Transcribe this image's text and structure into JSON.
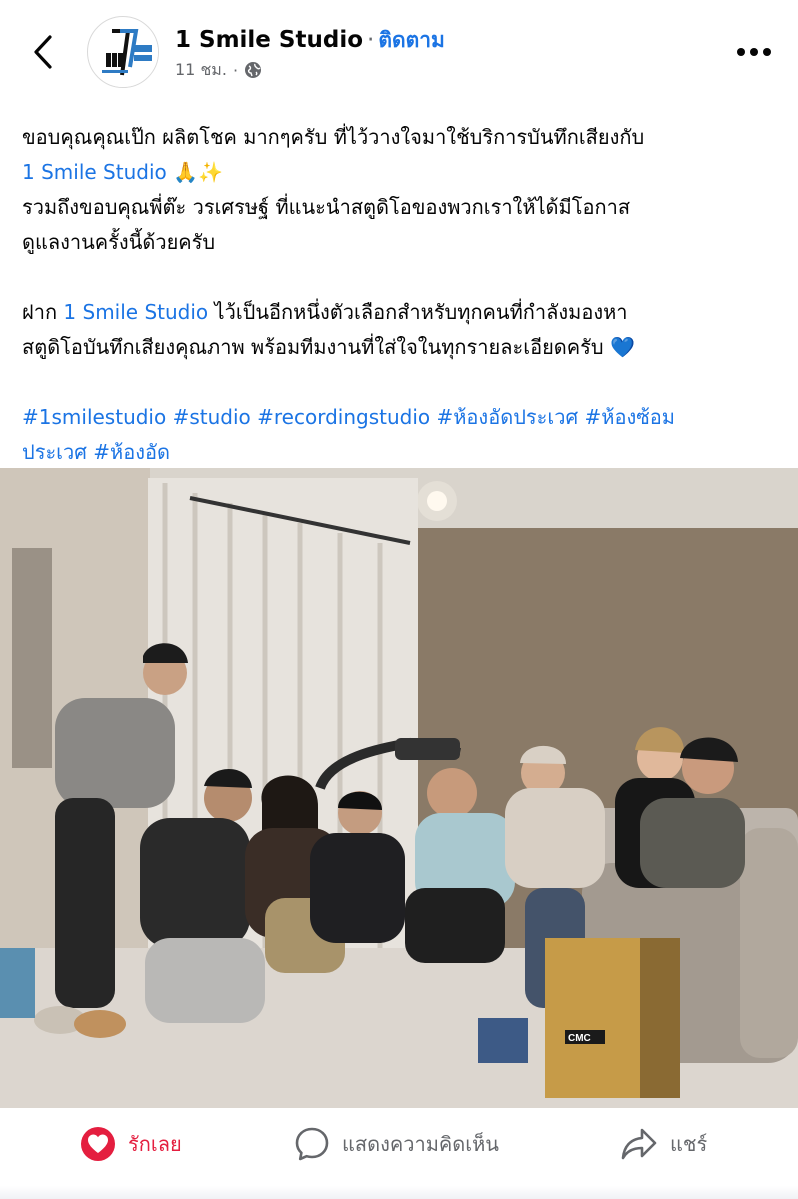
{
  "header": {
    "back_icon": "chevron-left-icon",
    "page_name": "1 Smile Studio",
    "separator": "·",
    "follow_label": "ติดตาม",
    "timestamp": "11 ชม.",
    "meta_separator": "·",
    "privacy_icon": "globe-icon",
    "more_icon": "more-horizontal-icon",
    "avatar_logo_text": "1 SMILE Studio"
  },
  "post": {
    "line1": "ขอบคุณคุณเป๊ก ผลิตโชค มากๆครับ ที่ไว้วางใจมาใช้บริการบันทึกเสียงกับ",
    "mention1": "1 Smile Studio",
    "emoji1": "🙏✨",
    "line2": "รวมถึงขอบคุณพี่ต๊ะ วรเศรษฐ์ ที่แนะนำสตูดิโอของพวกเราให้ได้มีโอกาส",
    "line3": "ดูแลงานครั้งนี้ด้วยครับ",
    "line4_prefix": "ฝาก",
    "mention2": "1 Smile Studio",
    "line4_suffix": "ไว้เป็นอีกหนึ่งตัวเลือกสำหรับทุกคนที่กำลังมองหา",
    "line5": "สตูดิโอบันทึกเสียงคุณภาพ พร้อมทีมงานที่ใส่ใจในทุกรายละเอียดครับ",
    "emoji2": "💙",
    "hashtags_line1": "#1smilestudio #studio #recordingstudio #ห้องอัดประเวศ #ห้องซ้อม",
    "hashtags_line2": "ประเวศ #ห้องอัด"
  },
  "photo": {
    "cajon_label": "CMC"
  },
  "actions": {
    "like_label": "รักเลย",
    "like_icon": "heart-reaction-icon",
    "comment_label": "แสดงความคิดเห็น",
    "comment_icon": "comment-bubble-icon",
    "share_label": "แชร์",
    "share_icon": "share-arrow-icon"
  },
  "colors": {
    "link": "#1b74e4",
    "love": "#e41e3f",
    "muted": "#65676b"
  }
}
